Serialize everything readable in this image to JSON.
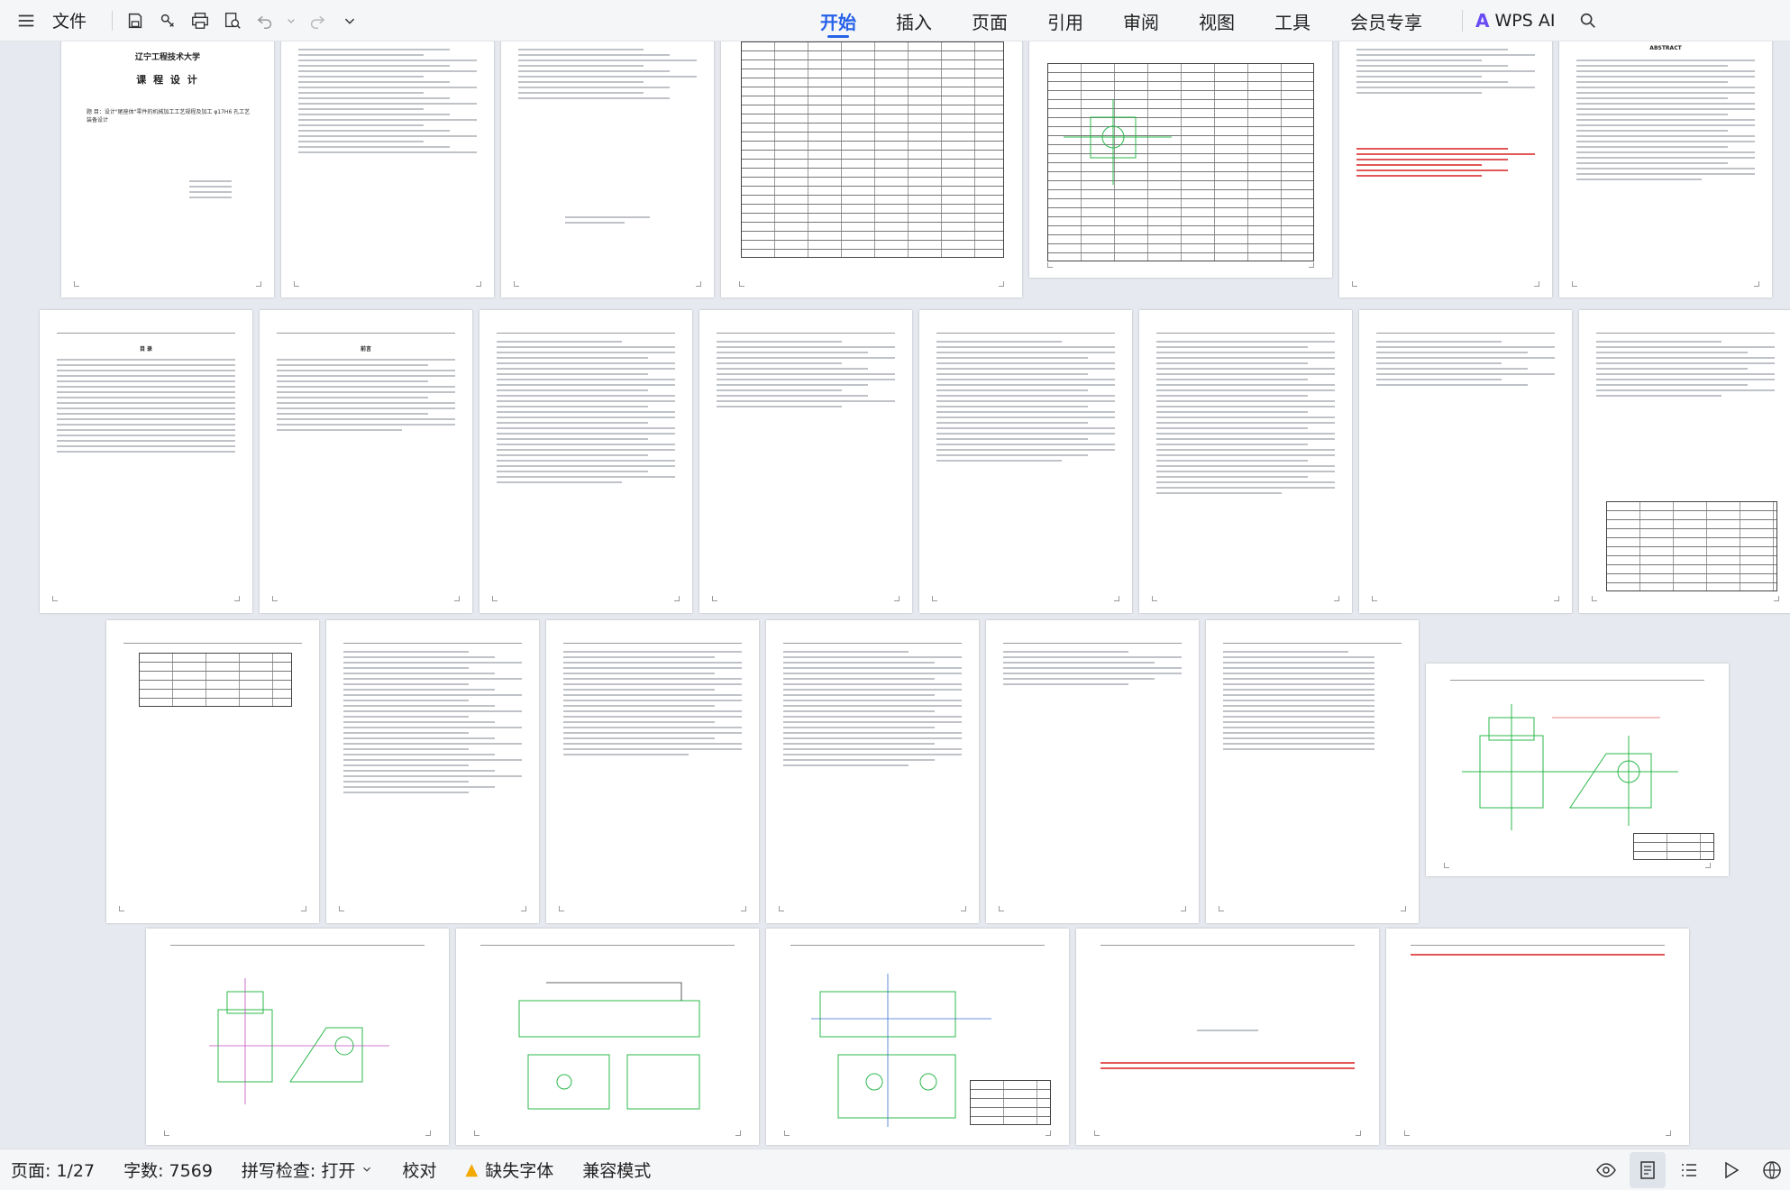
{
  "toolbar": {
    "file_label": "文件",
    "tabs": [
      {
        "label": "开始",
        "active": true
      },
      {
        "label": "插入",
        "active": false
      },
      {
        "label": "页面",
        "active": false
      },
      {
        "label": "引用",
        "active": false
      },
      {
        "label": "审阅",
        "active": false
      },
      {
        "label": "视图",
        "active": false
      },
      {
        "label": "工具",
        "active": false
      },
      {
        "label": "会员专享",
        "active": false
      }
    ],
    "ai_label": "WPS AI",
    "icons": [
      "menu-icon",
      "save-icon",
      "share-icon",
      "print-icon",
      "print-preview-icon",
      "undo-icon",
      "redo-icon",
      "chevron-down-icon",
      "search-icon"
    ]
  },
  "document": {
    "cover": {
      "school": "辽宁工程技术大学",
      "title": "课 程 设 计",
      "topic": "题 目：设计\"尾座体\"零件的机械加工工艺规程及加工 φ17H6 孔工艺装备设计"
    },
    "abstract_heading": "ABSTRACT",
    "toc_heading": "目 录",
    "preface_heading": "前言"
  },
  "statusbar": {
    "page": "页面: 1/27",
    "word_count": "字数: 7569",
    "spellcheck": "拼写检查: 打开",
    "proofread": "校对",
    "missing_font": "缺失字体",
    "compat_mode": "兼容模式"
  },
  "colors": {
    "accent": "#2762e8",
    "warning": "#f2a900",
    "red_text": "#e25656",
    "drawing_green": "#2bb84b"
  }
}
